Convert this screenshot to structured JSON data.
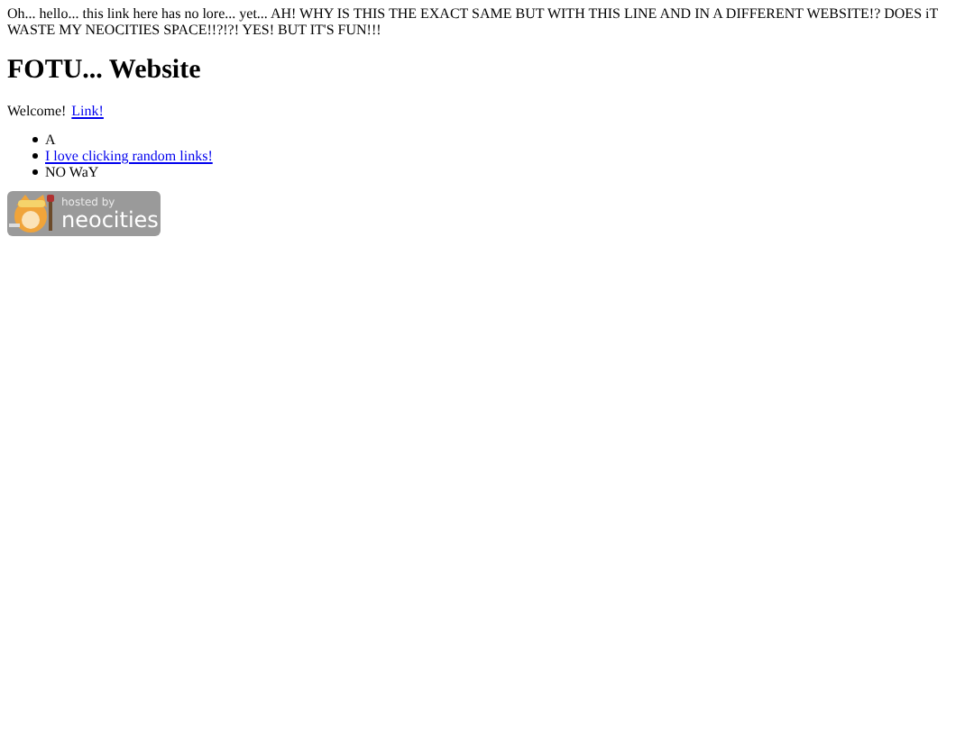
{
  "intro": "Oh... hello... this link here has no lore... yet... AH! WHY IS THIS THE EXACT SAME BUT WITH THIS LINE AND IN A DIFFERENT WEBSITE!? DOES iT WASTE MY NEOCITIES SPACE!!?!?! YES! BUT IT'S FUN!!!",
  "heading": "FOTU... Website",
  "welcome": {
    "text": "Welcome!",
    "link": "Link!"
  },
  "list": [
    {
      "kind": "text",
      "text": "A"
    },
    {
      "kind": "link",
      "text": "I love clicking random links!"
    },
    {
      "kind": "text",
      "text": "NO WaY"
    }
  ],
  "badge": {
    "top": "hosted by",
    "bottom": "neocities"
  }
}
